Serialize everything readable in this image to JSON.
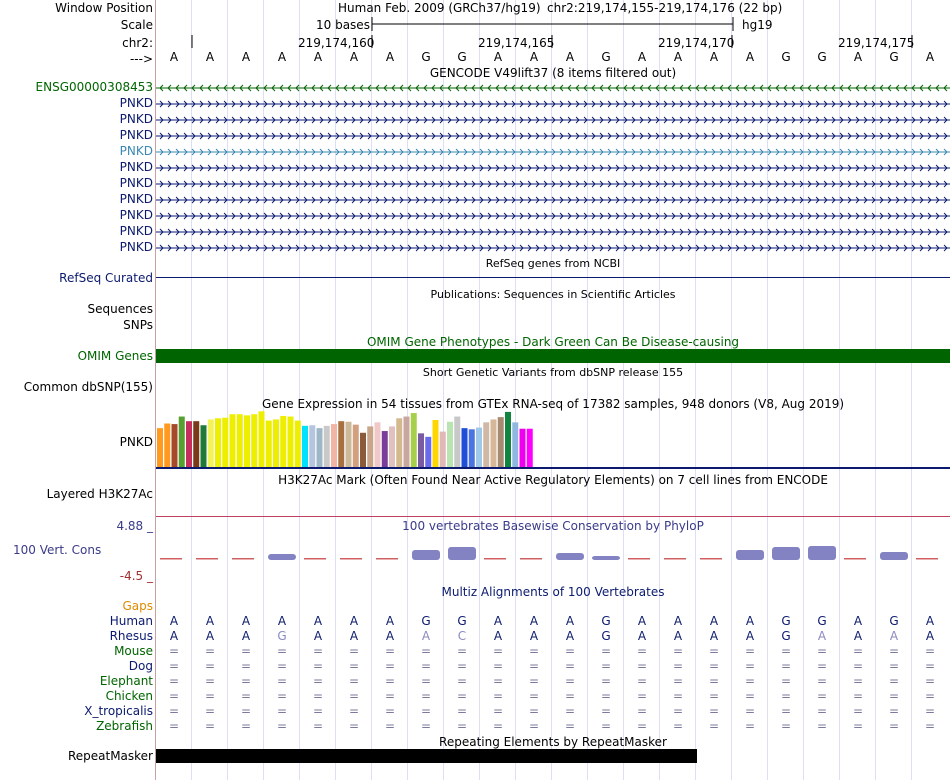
{
  "header": {
    "window_position_label": "Window Position",
    "scale_label": "Scale",
    "chr_label": "chr2:",
    "strand_label": "--->",
    "assembly_text": "Human Feb. 2009 (GRCh37/hg19)",
    "position_text": "chr2:219,174,155-219,174,176 (22 bp)",
    "scale_text": "10 bases",
    "db_text": "hg19",
    "ticks": [
      "219,174,160",
      "219,174,165",
      "219,174,170",
      "219,174,175"
    ]
  },
  "sequence": [
    "A",
    "A",
    "A",
    "A",
    "A",
    "A",
    "A",
    "G",
    "G",
    "A",
    "A",
    "A",
    "G",
    "A",
    "A",
    "A",
    "A",
    "G",
    "G",
    "A",
    "G",
    "A"
  ],
  "gencode": {
    "title": "GENCODE V49lift37 (8 items filtered out)",
    "genes": [
      "ENSG00000308453",
      "PNKD",
      "PNKD",
      "PNKD",
      "PNKD",
      "PNKD",
      "PNKD",
      "PNKD",
      "PNKD",
      "PNKD",
      "PNKD"
    ],
    "gene_colors": [
      "#006400",
      "#0b1a6e",
      "#0b1a6e",
      "#0b1a6e",
      "#3b88b5",
      "#0b1a6e",
      "#0b1a6e",
      "#0b1a6e",
      "#0b1a6e",
      "#0b1a6e",
      "#0b1a6e"
    ]
  },
  "refseq": {
    "title": "RefSeq genes from NCBI",
    "label": "RefSeq Curated"
  },
  "publications": {
    "title": "Publications: Sequences in Scientific Articles",
    "label1": "Sequences",
    "label2": "SNPs"
  },
  "omim": {
    "title": "OMIM Gene Phenotypes - Dark Green Can Be Disease-causing",
    "label": "OMIM Genes"
  },
  "dbsnp": {
    "title": "Short Genetic Variants from dbSNP release 155",
    "label": "Common dbSNP(155)"
  },
  "gtex": {
    "title": "Gene Expression in 54 tissues from GTEx RNA-seq of 17382 samples, 948 donors (V8, Aug 2019)",
    "label": "PNKD",
    "bars": [
      {
        "v": 0.67,
        "c": "#ff9a1f"
      },
      {
        "v": 0.75,
        "c": "#ff9a1f"
      },
      {
        "v": 0.74,
        "c": "#a54a2a"
      },
      {
        "v": 0.87,
        "c": "#55a02e"
      },
      {
        "v": 0.79,
        "c": "#c72e5d"
      },
      {
        "v": 0.79,
        "c": "#7a3a1a"
      },
      {
        "v": 0.72,
        "c": "#1f7a3a"
      },
      {
        "v": 0.82,
        "c": "#f2f25a"
      },
      {
        "v": 0.84,
        "c": "#eeee00"
      },
      {
        "v": 0.85,
        "c": "#eeee00"
      },
      {
        "v": 0.91,
        "c": "#eeee00"
      },
      {
        "v": 0.91,
        "c": "#eeee00"
      },
      {
        "v": 0.89,
        "c": "#eeee00"
      },
      {
        "v": 0.91,
        "c": "#eeee00"
      },
      {
        "v": 0.96,
        "c": "#eeee00"
      },
      {
        "v": 0.8,
        "c": "#eeee00"
      },
      {
        "v": 0.82,
        "c": "#eeee00"
      },
      {
        "v": 0.88,
        "c": "#eeee00"
      },
      {
        "v": 0.87,
        "c": "#eeee00"
      },
      {
        "v": 0.8,
        "c": "#eeee00"
      },
      {
        "v": 0.71,
        "c": "#00e0ff"
      },
      {
        "v": 0.72,
        "c": "#b5c5e0"
      },
      {
        "v": 0.67,
        "c": "#9db7c7"
      },
      {
        "v": 0.71,
        "c": "#c9c9c9"
      },
      {
        "v": 0.74,
        "c": "#f2b5a5"
      },
      {
        "v": 0.79,
        "c": "#a87040"
      },
      {
        "v": 0.78,
        "c": "#ccb89a"
      },
      {
        "v": 0.73,
        "c": "#d2a07f"
      },
      {
        "v": 0.59,
        "c": "#8b5a3a"
      },
      {
        "v": 0.7,
        "c": "#c9a68a"
      },
      {
        "v": 0.77,
        "c": "#f0c8c8"
      },
      {
        "v": 0.62,
        "c": "#7a3d9a"
      },
      {
        "v": 0.7,
        "c": "#e1c0c0"
      },
      {
        "v": 0.84,
        "c": "#d4b98e"
      },
      {
        "v": 0.87,
        "c": "#c9a6a0"
      },
      {
        "v": 0.93,
        "c": "#a6d04b"
      },
      {
        "v": 0.58,
        "c": "#7a5aa0"
      },
      {
        "v": 0.52,
        "c": "#6a6aee"
      },
      {
        "v": 0.81,
        "c": "#ffd700"
      },
      {
        "v": 0.61,
        "c": "#e0b8b8"
      },
      {
        "v": 0.78,
        "c": "#b9e3b0"
      },
      {
        "v": 0.87,
        "c": "#c8c8c8"
      },
      {
        "v": 0.67,
        "c": "#1f4fd8"
      },
      {
        "v": 0.65,
        "c": "#4b74e0"
      },
      {
        "v": 0.68,
        "c": "#a0c8e8"
      },
      {
        "v": 0.77,
        "c": "#d0b8a6"
      },
      {
        "v": 0.82,
        "c": "#d6b79a"
      },
      {
        "v": 0.86,
        "c": "#a88a70"
      },
      {
        "v": 0.95,
        "c": "#118540"
      },
      {
        "v": 0.77,
        "c": "#8fb8e0"
      },
      {
        "v": 0.66,
        "c": "#ee00ee"
      },
      {
        "v": 0.66,
        "c": "#ff00ff"
      }
    ]
  },
  "h3k27ac": {
    "title": "H3K27Ac Mark (Often Found Near Active Regulatory Elements) on 7 cell lines from ENCODE",
    "label": "Layered H3K27Ac"
  },
  "phylop": {
    "title": "100 vertebrates Basewise Conservation by PhyloP",
    "label": "100 Vert. Cons",
    "max_label": "4.88 _",
    "min_label": "-4.5 _",
    "values": [
      -0.3,
      -0.3,
      -0.3,
      0.4,
      -0.3,
      -0.3,
      -0.3,
      0.8,
      1.1,
      -0.3,
      -0.3,
      0.5,
      0.2,
      -0.3,
      -0.3,
      -0.3,
      0.8,
      1.1,
      1.2,
      -0.3,
      0.6,
      -0.3
    ]
  },
  "multiz": {
    "title": "Multiz Alignments of 100 Vertebrates",
    "gaps_label": "Gaps",
    "species": [
      {
        "name": "Human",
        "color": "#0b1a6e",
        "seq": [
          "A",
          "A",
          "A",
          "A",
          "A",
          "A",
          "A",
          "G",
          "G",
          "A",
          "A",
          "A",
          "G",
          "A",
          "A",
          "A",
          "A",
          "G",
          "G",
          "A",
          "G",
          "A"
        ]
      },
      {
        "name": "Rhesus",
        "color": "#0b1a6e",
        "seq": [
          "A",
          "A",
          "A",
          "G",
          "A",
          "A",
          "A",
          "A",
          "C",
          "A",
          "A",
          "A",
          "G",
          "A",
          "A",
          "A",
          "A",
          "G",
          "A",
          "A",
          "A",
          "A"
        ]
      },
      {
        "name": "Mouse",
        "color": "#006400",
        "seq": [
          "=",
          "=",
          "=",
          "=",
          "=",
          "=",
          "=",
          "=",
          "=",
          "=",
          "=",
          "=",
          "=",
          "=",
          "=",
          "=",
          "=",
          "=",
          "=",
          "=",
          "=",
          "="
        ]
      },
      {
        "name": "Dog",
        "color": "#0b1a6e",
        "seq": [
          "=",
          "=",
          "=",
          "=",
          "=",
          "=",
          "=",
          "=",
          "=",
          "=",
          "=",
          "=",
          "=",
          "=",
          "=",
          "=",
          "=",
          "=",
          "=",
          "=",
          "=",
          "="
        ]
      },
      {
        "name": "Elephant",
        "color": "#006400",
        "seq": [
          "=",
          "=",
          "=",
          "=",
          "=",
          "=",
          "=",
          "=",
          "=",
          "=",
          "=",
          "=",
          "=",
          "=",
          "=",
          "=",
          "=",
          "=",
          "=",
          "=",
          "=",
          "="
        ]
      },
      {
        "name": "Chicken",
        "color": "#006400",
        "seq": [
          "=",
          "=",
          "=",
          "=",
          "=",
          "=",
          "=",
          "=",
          "=",
          "=",
          "=",
          "=",
          "=",
          "=",
          "=",
          "=",
          "=",
          "=",
          "=",
          "=",
          "=",
          "="
        ]
      },
      {
        "name": "X_tropicalis",
        "color": "#0b1a6e",
        "seq": [
          "=",
          "=",
          "=",
          "=",
          "=",
          "=",
          "=",
          "=",
          "=",
          "=",
          "=",
          "=",
          "=",
          "=",
          "=",
          "=",
          "=",
          "=",
          "=",
          "=",
          "=",
          "="
        ]
      },
      {
        "name": "Zebrafish",
        "color": "#006400",
        "seq": [
          "=",
          "=",
          "=",
          "=",
          "=",
          "=",
          "=",
          "=",
          "=",
          "=",
          "=",
          "=",
          "=",
          "=",
          "=",
          "=",
          "=",
          "=",
          "=",
          "=",
          "=",
          "="
        ]
      }
    ]
  },
  "repeatmasker": {
    "title": "Repeating Elements by RepeatMasker",
    "label": "RepeatMasker"
  },
  "colors": {
    "navy": "#0b1a6e",
    "omim_green": "#006400",
    "gaps_orange": "#e08a00",
    "phylop_blue": "#3a3a8a",
    "phylop_red": "#a03030"
  }
}
